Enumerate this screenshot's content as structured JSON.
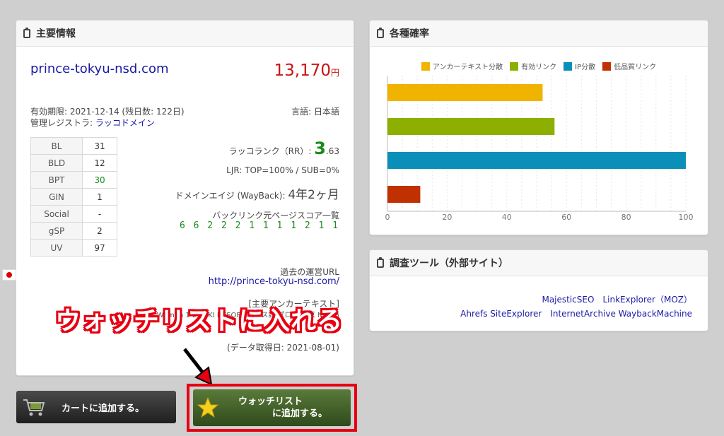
{
  "main_panel": {
    "title": "主要情報",
    "domain": "prince-tokyu-nsd.com",
    "price": "13,170",
    "price_unit": "円",
    "expiry": "有効期限: 2021-12-14 (残日数: 122日)",
    "registrar_label": "管理レジストラ: ",
    "registrar_name": "ラッコドメイン",
    "language": "言語: 日本語",
    "metrics": [
      {
        "key": "BL",
        "value": "31"
      },
      {
        "key": "BLD",
        "value": "12"
      },
      {
        "key": "BPT",
        "value": "30"
      },
      {
        "key": "GIN",
        "value": "1"
      },
      {
        "key": "Social",
        "value": "-"
      },
      {
        "key": "gSP",
        "value": "2"
      },
      {
        "key": "UV",
        "value": "97"
      }
    ],
    "rakko_rank_label": "ラッコランク（RR）: ",
    "rakko_rank_int": "3",
    "rakko_rank_dec": ".63",
    "ljr": "LJR: TOP=100% / SUB=0%",
    "domain_age_label": "ドメインエイジ (WayBack): ",
    "domain_age_value": "4年2ヶ月",
    "backlink_score_label": "バックリンク元ページスコア一覧",
    "backlink_scores": "6 6 2 2 2 1 1 1 1 2 1 1",
    "past_url_label": "過去の運営URL",
    "past_url": "http://prince-tokyu-nsd.com/",
    "anchor_label": "[主要アンカーテキスト]",
    "anchor_text": "ROXY  Women  1 27 SKI RESORT  コース詳  ブログ  東京  NSD  5",
    "data_date": "(データ取得日: 2021-08-01)"
  },
  "overlay_text": "ウォッチリストに入れる",
  "probability_panel": {
    "title": "各種確率",
    "chart_data": {
      "type": "bar",
      "orientation": "horizontal",
      "categories": [
        "アンカーテキスト分散",
        "有効リンク",
        "IP分散",
        "低品質リンク"
      ],
      "values": [
        52,
        56,
        100,
        11
      ],
      "colors": [
        "#f0b400",
        "#8db000",
        "#0a8fb8",
        "#c03000"
      ],
      "xlim": [
        0,
        100
      ],
      "xticks": [
        0,
        20,
        40,
        60,
        80,
        100
      ],
      "legend_position": "top",
      "grid": true
    }
  },
  "tools_panel": {
    "title": "調査ツール（外部サイト）",
    "links_row1": [
      "MajesticSEO",
      "LinkExplorer（MOZ）"
    ],
    "links_row2": [
      "Ahrefs SiteExplorer",
      "InternetArchive WaybackMachine"
    ]
  },
  "buttons": {
    "cart_label": "カートに追加する。",
    "watch_line1": "ウォッチリスト",
    "watch_line2": "に追加する。"
  }
}
